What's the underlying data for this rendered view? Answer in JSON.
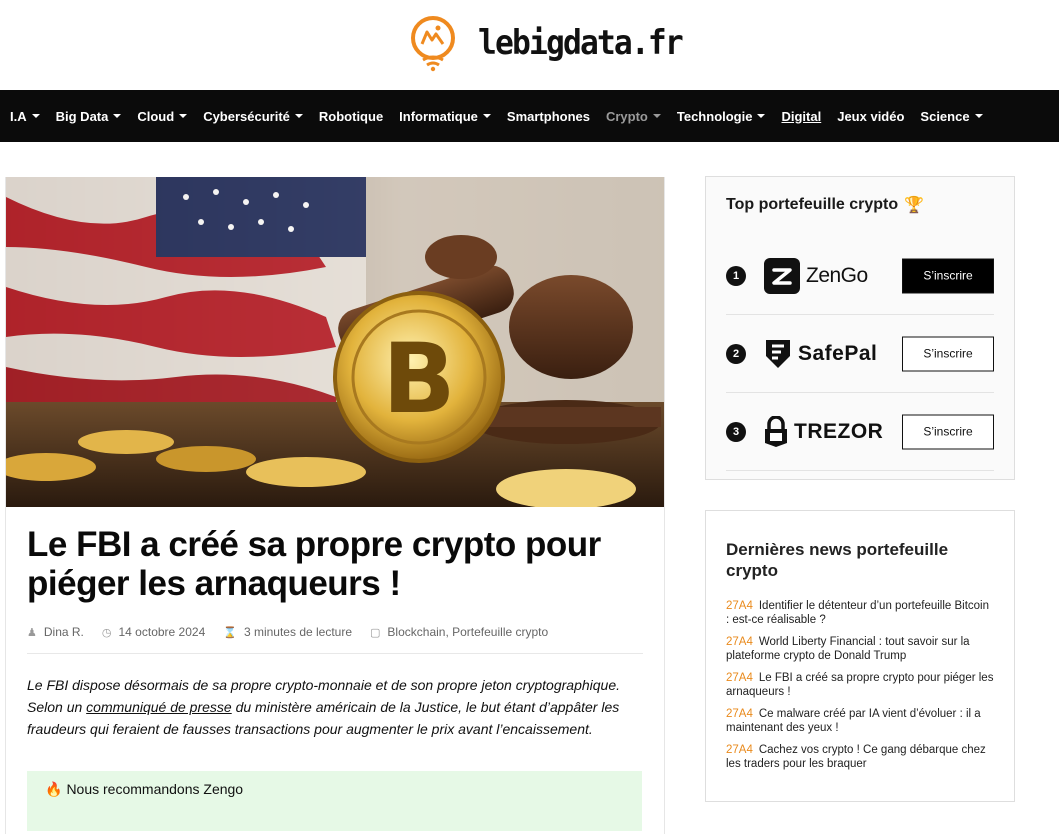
{
  "site": {
    "name": "lebigdata.fr"
  },
  "nav": {
    "items": [
      {
        "label": "I.A",
        "dropdown": true
      },
      {
        "label": "Big Data",
        "dropdown": true
      },
      {
        "label": "Cloud",
        "dropdown": true
      },
      {
        "label": "Cybersécurité",
        "dropdown": true
      },
      {
        "label": "Robotique",
        "dropdown": false
      },
      {
        "label": "Informatique",
        "dropdown": true
      },
      {
        "label": "Smartphones",
        "dropdown": false
      },
      {
        "label": "Crypto",
        "dropdown": true,
        "active": true
      },
      {
        "label": "Technologie",
        "dropdown": true
      },
      {
        "label": "Digital",
        "dropdown": false,
        "underline": true
      },
      {
        "label": "Jeux vidéo",
        "dropdown": false
      },
      {
        "label": "Science",
        "dropdown": true
      }
    ]
  },
  "article": {
    "title": "Le FBI a créé sa propre crypto pour piéger les arnaqueurs !",
    "author": "Dina R.",
    "date": "14 octobre 2024",
    "reading_time": "3 minutes de lecture",
    "categories": "Blockchain, Portefeuille crypto",
    "intro_before_link": "Le FBI dispose désormais de sa propre crypto-monnaie et de son propre jeton cryptographique. Selon un ",
    "intro_link": "communiqué de presse",
    "intro_after_link": " du ministère américain de la Justice, le but étant d’appâter les fraudeurs qui feraient de fausses transactions pour augmenter le prix avant l’encaissement.",
    "recommend": "Nous recommandons Zengo",
    "recommend_icon": "🔥"
  },
  "top_wallets": {
    "title": "Top portefeuille crypto",
    "title_icon": "🏆",
    "items": [
      {
        "rank": "1",
        "name": "ZenGo",
        "button": "S’inscrire",
        "style": "dark"
      },
      {
        "rank": "2",
        "name": "SafePal",
        "button": "S’inscrire",
        "style": "light"
      },
      {
        "rank": "3",
        "name": "TREZOR",
        "button": "S’inscrire",
        "style": "light"
      }
    ]
  },
  "latest_news": {
    "title": "Dernières news portefeuille crypto",
    "items": [
      {
        "code": "27A4",
        "text": "Identifier le détenteur d’un portefeuille Bitcoin : est-ce réalisable ?"
      },
      {
        "code": "27A4",
        "text": "World Liberty Financial : tout savoir sur la plateforme crypto de Donald Trump"
      },
      {
        "code": "27A4",
        "text": "Le FBI a créé sa propre crypto pour piéger les arnaqueurs !"
      },
      {
        "code": "27A4",
        "text": "Ce malware créé par IA vient d’évoluer : il a maintenant des yeux !"
      },
      {
        "code": "27A4",
        "text": "Cachez vos crypto ! Ce gang débarque chez les traders pour les braquer"
      }
    ]
  },
  "colors": {
    "accent": "#e98a1c",
    "nav_bg": "#0b0b0b",
    "reco_bg": "#e6f9e6"
  }
}
